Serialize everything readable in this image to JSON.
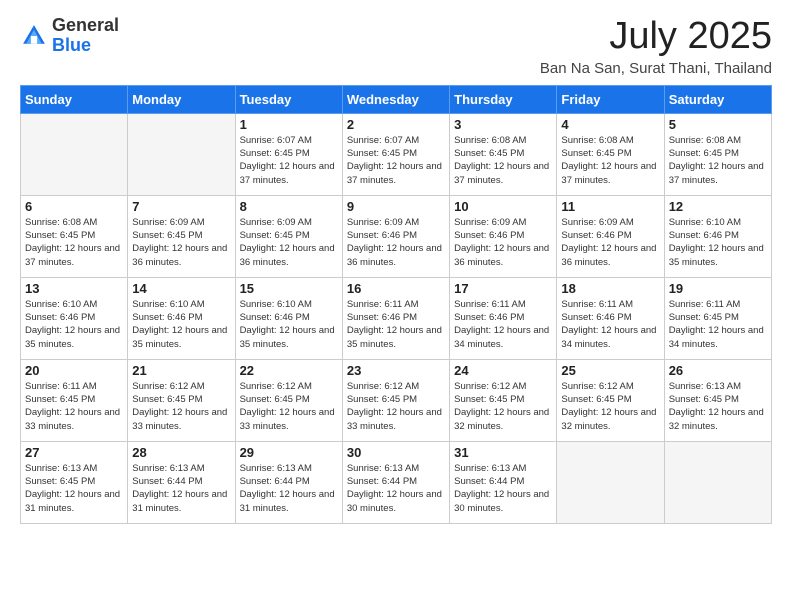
{
  "header": {
    "logo_general": "General",
    "logo_blue": "Blue",
    "month_title": "July 2025",
    "location": "Ban Na San, Surat Thani, Thailand"
  },
  "days_of_week": [
    "Sunday",
    "Monday",
    "Tuesday",
    "Wednesday",
    "Thursday",
    "Friday",
    "Saturday"
  ],
  "weeks": [
    [
      {
        "day": null,
        "empty": true
      },
      {
        "day": null,
        "empty": true
      },
      {
        "day": 1,
        "sunrise": "6:07 AM",
        "sunset": "6:45 PM",
        "daylight": "12 hours and 37 minutes."
      },
      {
        "day": 2,
        "sunrise": "6:07 AM",
        "sunset": "6:45 PM",
        "daylight": "12 hours and 37 minutes."
      },
      {
        "day": 3,
        "sunrise": "6:08 AM",
        "sunset": "6:45 PM",
        "daylight": "12 hours and 37 minutes."
      },
      {
        "day": 4,
        "sunrise": "6:08 AM",
        "sunset": "6:45 PM",
        "daylight": "12 hours and 37 minutes."
      },
      {
        "day": 5,
        "sunrise": "6:08 AM",
        "sunset": "6:45 PM",
        "daylight": "12 hours and 37 minutes."
      }
    ],
    [
      {
        "day": 6,
        "sunrise": "6:08 AM",
        "sunset": "6:45 PM",
        "daylight": "12 hours and 37 minutes."
      },
      {
        "day": 7,
        "sunrise": "6:09 AM",
        "sunset": "6:45 PM",
        "daylight": "12 hours and 36 minutes."
      },
      {
        "day": 8,
        "sunrise": "6:09 AM",
        "sunset": "6:45 PM",
        "daylight": "12 hours and 36 minutes."
      },
      {
        "day": 9,
        "sunrise": "6:09 AM",
        "sunset": "6:46 PM",
        "daylight": "12 hours and 36 minutes."
      },
      {
        "day": 10,
        "sunrise": "6:09 AM",
        "sunset": "6:46 PM",
        "daylight": "12 hours and 36 minutes."
      },
      {
        "day": 11,
        "sunrise": "6:09 AM",
        "sunset": "6:46 PM",
        "daylight": "12 hours and 36 minutes."
      },
      {
        "day": 12,
        "sunrise": "6:10 AM",
        "sunset": "6:46 PM",
        "daylight": "12 hours and 35 minutes."
      }
    ],
    [
      {
        "day": 13,
        "sunrise": "6:10 AM",
        "sunset": "6:46 PM",
        "daylight": "12 hours and 35 minutes."
      },
      {
        "day": 14,
        "sunrise": "6:10 AM",
        "sunset": "6:46 PM",
        "daylight": "12 hours and 35 minutes."
      },
      {
        "day": 15,
        "sunrise": "6:10 AM",
        "sunset": "6:46 PM",
        "daylight": "12 hours and 35 minutes."
      },
      {
        "day": 16,
        "sunrise": "6:11 AM",
        "sunset": "6:46 PM",
        "daylight": "12 hours and 35 minutes."
      },
      {
        "day": 17,
        "sunrise": "6:11 AM",
        "sunset": "6:46 PM",
        "daylight": "12 hours and 34 minutes."
      },
      {
        "day": 18,
        "sunrise": "6:11 AM",
        "sunset": "6:46 PM",
        "daylight": "12 hours and 34 minutes."
      },
      {
        "day": 19,
        "sunrise": "6:11 AM",
        "sunset": "6:45 PM",
        "daylight": "12 hours and 34 minutes."
      }
    ],
    [
      {
        "day": 20,
        "sunrise": "6:11 AM",
        "sunset": "6:45 PM",
        "daylight": "12 hours and 33 minutes."
      },
      {
        "day": 21,
        "sunrise": "6:12 AM",
        "sunset": "6:45 PM",
        "daylight": "12 hours and 33 minutes."
      },
      {
        "day": 22,
        "sunrise": "6:12 AM",
        "sunset": "6:45 PM",
        "daylight": "12 hours and 33 minutes."
      },
      {
        "day": 23,
        "sunrise": "6:12 AM",
        "sunset": "6:45 PM",
        "daylight": "12 hours and 33 minutes."
      },
      {
        "day": 24,
        "sunrise": "6:12 AM",
        "sunset": "6:45 PM",
        "daylight": "12 hours and 32 minutes."
      },
      {
        "day": 25,
        "sunrise": "6:12 AM",
        "sunset": "6:45 PM",
        "daylight": "12 hours and 32 minutes."
      },
      {
        "day": 26,
        "sunrise": "6:13 AM",
        "sunset": "6:45 PM",
        "daylight": "12 hours and 32 minutes."
      }
    ],
    [
      {
        "day": 27,
        "sunrise": "6:13 AM",
        "sunset": "6:45 PM",
        "daylight": "12 hours and 31 minutes."
      },
      {
        "day": 28,
        "sunrise": "6:13 AM",
        "sunset": "6:44 PM",
        "daylight": "12 hours and 31 minutes."
      },
      {
        "day": 29,
        "sunrise": "6:13 AM",
        "sunset": "6:44 PM",
        "daylight": "12 hours and 31 minutes."
      },
      {
        "day": 30,
        "sunrise": "6:13 AM",
        "sunset": "6:44 PM",
        "daylight": "12 hours and 30 minutes."
      },
      {
        "day": 31,
        "sunrise": "6:13 AM",
        "sunset": "6:44 PM",
        "daylight": "12 hours and 30 minutes."
      },
      {
        "day": null,
        "empty": true,
        "shaded": true
      },
      {
        "day": null,
        "empty": true,
        "shaded": true
      }
    ]
  ]
}
